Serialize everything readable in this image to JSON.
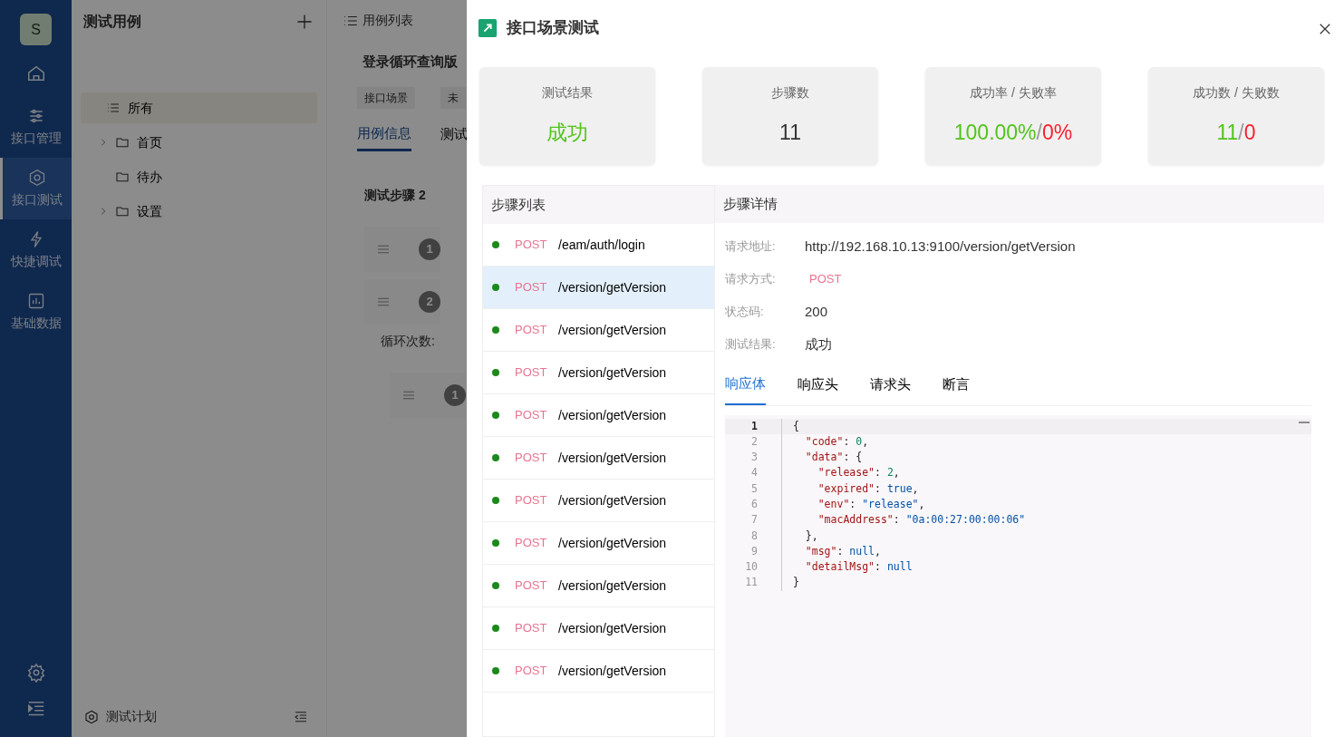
{
  "nav": {
    "avatar": "S",
    "items": [
      {
        "label": "接口管理",
        "selected": false
      },
      {
        "label": "接口测试",
        "selected": true
      },
      {
        "label": "快捷调试",
        "selected": false
      },
      {
        "label": "基础数据",
        "selected": false
      }
    ]
  },
  "tree": {
    "title": "测试用例",
    "items": [
      {
        "label": "所有",
        "kind": "all",
        "selected": true,
        "expandable": false
      },
      {
        "label": "首页",
        "kind": "folder",
        "selected": false,
        "expandable": true
      },
      {
        "label": "待办",
        "kind": "folder",
        "selected": false,
        "expandable": false
      },
      {
        "label": "设置",
        "kind": "folder",
        "selected": false,
        "expandable": true
      }
    ],
    "footer": "测试计划"
  },
  "case": {
    "list_title": "用例列表",
    "title": "登录循环查询版",
    "tags": [
      "接口场景",
      "未"
    ],
    "tabs": [
      {
        "label": "用例信息",
        "selected": true
      },
      {
        "label": "测试",
        "selected": false
      }
    ],
    "steps_title": "测试步骤 2",
    "step_numbers": [
      "1",
      "2"
    ],
    "loop_label": "循环次数:",
    "sub_step_number": "1"
  },
  "drawer": {
    "title": "接口场景测试",
    "stats": [
      {
        "label": "测试结果",
        "parts": [
          {
            "text": "成功",
            "color": "#52c41a"
          }
        ]
      },
      {
        "label": "步骤数",
        "parts": [
          {
            "text": "11",
            "color": "#333333"
          }
        ]
      },
      {
        "label": "成功率 / 失败率",
        "parts": [
          {
            "text": "100.00%",
            "color": "#52c41a"
          },
          {
            "text": "/",
            "color": "#999999"
          },
          {
            "text": "0%",
            "color": "#f5222d"
          }
        ]
      },
      {
        "label": "成功数 / 失败数",
        "parts": [
          {
            "text": "11",
            "color": "#52c41a"
          },
          {
            "text": "/",
            "color": "#999999"
          },
          {
            "text": "0",
            "color": "#f5222d"
          }
        ]
      }
    ],
    "steps_title": "步骤列表",
    "steps": [
      {
        "method": "POST",
        "path": "/eam/auth/login",
        "color": "#1a8a1a",
        "selected": false
      },
      {
        "method": "POST",
        "path": "/version/getVersion",
        "color": "#1a8a1a",
        "selected": true
      },
      {
        "method": "POST",
        "path": "/version/getVersion",
        "color": "#1a8a1a",
        "selected": false
      },
      {
        "method": "POST",
        "path": "/version/getVersion",
        "color": "#1a8a1a",
        "selected": false
      },
      {
        "method": "POST",
        "path": "/version/getVersion",
        "color": "#1a8a1a",
        "selected": false
      },
      {
        "method": "POST",
        "path": "/version/getVersion",
        "color": "#1a8a1a",
        "selected": false
      },
      {
        "method": "POST",
        "path": "/version/getVersion",
        "color": "#1a8a1a",
        "selected": false
      },
      {
        "method": "POST",
        "path": "/version/getVersion",
        "color": "#1a8a1a",
        "selected": false
      },
      {
        "method": "POST",
        "path": "/version/getVersion",
        "color": "#1a8a1a",
        "selected": false
      },
      {
        "method": "POST",
        "path": "/version/getVersion",
        "color": "#1a8a1a",
        "selected": false
      },
      {
        "method": "POST",
        "path": "/version/getVersion",
        "color": "#1a8a1a",
        "selected": false
      }
    ],
    "detail_title": "步骤详情",
    "fields": [
      {
        "label": "请求地址:",
        "value": "http://192.168.10.13:9100/version/getVersion",
        "kind": "text"
      },
      {
        "label": "请求方式:",
        "value": "POST",
        "kind": "method"
      },
      {
        "label": "状态码:",
        "value": "200",
        "kind": "text"
      },
      {
        "label": "测试结果:",
        "value": "成功",
        "kind": "text"
      }
    ],
    "tabs": [
      {
        "label": "响应体",
        "selected": true
      },
      {
        "label": "响应头",
        "selected": false
      },
      {
        "label": "请求头",
        "selected": false
      },
      {
        "label": "断言",
        "selected": false
      }
    ],
    "code_lines": [
      {
        "number": "1",
        "active": true,
        "tokens": [
          {
            "kind": "punct",
            "text": "{"
          }
        ]
      },
      {
        "number": "2",
        "active": false,
        "tokens": [
          {
            "kind": "key",
            "text": "  \"code\""
          },
          {
            "kind": "punct",
            "text": ": "
          },
          {
            "kind": "number",
            "text": "0"
          },
          {
            "kind": "punct",
            "text": ","
          }
        ]
      },
      {
        "number": "3",
        "active": false,
        "tokens": [
          {
            "kind": "key",
            "text": "  \"data\""
          },
          {
            "kind": "punct",
            "text": ": {"
          }
        ]
      },
      {
        "number": "4",
        "active": false,
        "tokens": [
          {
            "kind": "key",
            "text": "    \"release\""
          },
          {
            "kind": "punct",
            "text": ": "
          },
          {
            "kind": "number",
            "text": "2"
          },
          {
            "kind": "punct",
            "text": ","
          }
        ]
      },
      {
        "number": "5",
        "active": false,
        "tokens": [
          {
            "kind": "key",
            "text": "    \"expired\""
          },
          {
            "kind": "punct",
            "text": ": "
          },
          {
            "kind": "literal",
            "text": "true"
          },
          {
            "kind": "punct",
            "text": ","
          }
        ]
      },
      {
        "number": "6",
        "active": false,
        "tokens": [
          {
            "kind": "key",
            "text": "    \"env\""
          },
          {
            "kind": "punct",
            "text": ": "
          },
          {
            "kind": "string",
            "text": "\"release\""
          },
          {
            "kind": "punct",
            "text": ","
          }
        ]
      },
      {
        "number": "7",
        "active": false,
        "tokens": [
          {
            "kind": "key",
            "text": "    \"macAddress\""
          },
          {
            "kind": "punct",
            "text": ": "
          },
          {
            "kind": "string",
            "text": "\"0a:00:27:00:00:06\""
          }
        ]
      },
      {
        "number": "8",
        "active": false,
        "tokens": [
          {
            "kind": "punct",
            "text": "  },"
          }
        ]
      },
      {
        "number": "9",
        "active": false,
        "tokens": [
          {
            "kind": "key",
            "text": "  \"msg\""
          },
          {
            "kind": "punct",
            "text": ": "
          },
          {
            "kind": "literal",
            "text": "null"
          },
          {
            "kind": "punct",
            "text": ","
          }
        ]
      },
      {
        "number": "10",
        "active": false,
        "tokens": [
          {
            "kind": "key",
            "text": "  \"detailMsg\""
          },
          {
            "kind": "punct",
            "text": ": "
          },
          {
            "kind": "literal",
            "text": "null"
          }
        ]
      },
      {
        "number": "11",
        "active": false,
        "tokens": [
          {
            "kind": "punct",
            "text": "}"
          }
        ]
      }
    ]
  }
}
